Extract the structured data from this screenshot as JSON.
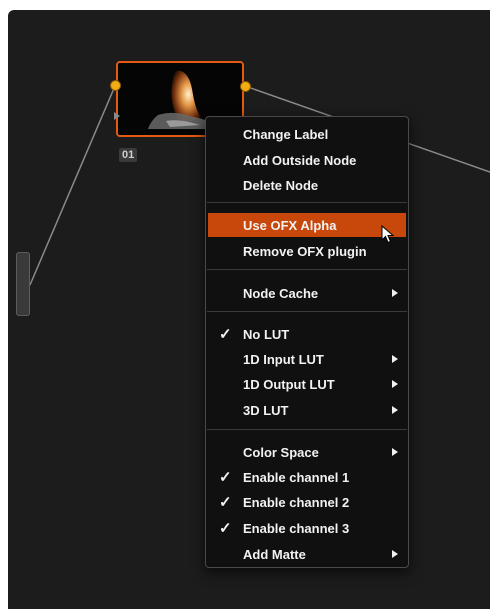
{
  "node": {
    "label": "01"
  },
  "menu": {
    "items": [
      {
        "label": "Change Label",
        "checked": false,
        "submenu": false
      },
      {
        "label": "Add Outside Node",
        "checked": false,
        "submenu": false
      },
      {
        "label": "Delete Node",
        "checked": false,
        "submenu": false
      },
      {
        "label": "Use OFX Alpha",
        "checked": false,
        "submenu": false,
        "highlighted": true
      },
      {
        "label": "Remove OFX plugin",
        "checked": false,
        "submenu": false
      },
      {
        "label": "Node Cache",
        "checked": false,
        "submenu": true
      },
      {
        "label": "No LUT",
        "checked": true,
        "submenu": false
      },
      {
        "label": "1D Input LUT",
        "checked": false,
        "submenu": true
      },
      {
        "label": "1D Output LUT",
        "checked": false,
        "submenu": true
      },
      {
        "label": "3D LUT",
        "checked": false,
        "submenu": true
      },
      {
        "label": "Color Space",
        "checked": false,
        "submenu": true
      },
      {
        "label": "Enable channel 1",
        "checked": true,
        "submenu": false
      },
      {
        "label": "Enable channel 2",
        "checked": true,
        "submenu": false
      },
      {
        "label": "Enable channel 3",
        "checked": true,
        "submenu": false
      },
      {
        "label": "Add Matte",
        "checked": false,
        "submenu": true
      }
    ],
    "check_glyph": "✓"
  },
  "colors": {
    "highlight": "#c8470b",
    "node_border": "#e55a12",
    "port": "#f2ac14",
    "background": "#1c1c1c"
  },
  "icons": {
    "check": "checkmark-icon",
    "submenu": "submenu-arrow-icon",
    "cursor": "mouse-pointer-icon"
  }
}
